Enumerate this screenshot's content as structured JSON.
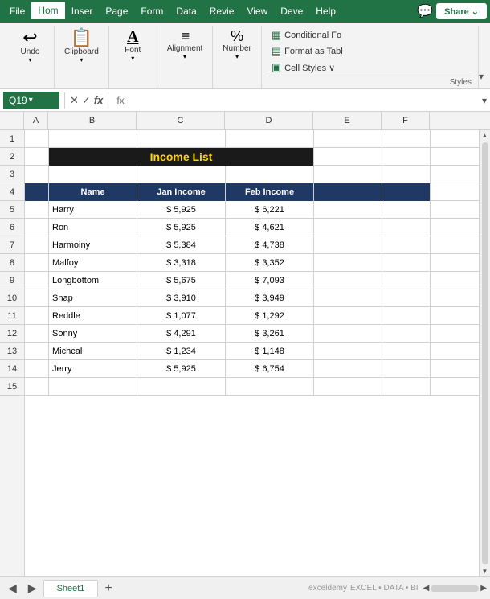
{
  "menu": {
    "items": [
      {
        "label": "File",
        "active": false
      },
      {
        "label": "Hom",
        "active": true
      },
      {
        "label": "Inser",
        "active": false
      },
      {
        "label": "Page",
        "active": false
      },
      {
        "label": "Form",
        "active": false
      },
      {
        "label": "Data",
        "active": false
      },
      {
        "label": "Revie",
        "active": false
      },
      {
        "label": "View",
        "active": false
      },
      {
        "label": "Deve",
        "active": false
      },
      {
        "label": "Help",
        "active": false
      }
    ],
    "share_label": "Share"
  },
  "ribbon": {
    "groups": [
      {
        "label": "Undo",
        "icon": "↩"
      },
      {
        "label": "Clipboard",
        "icon": "📋"
      },
      {
        "label": "Font",
        "icon": "A"
      },
      {
        "label": "Alignment",
        "icon": "≡"
      },
      {
        "label": "Number",
        "icon": "%"
      }
    ],
    "right_items": [
      {
        "label": "Conditional Fo",
        "icon": "▦"
      },
      {
        "label": "Format as Tabl",
        "icon": "▤"
      },
      {
        "label": "Cell Styles ∨",
        "icon": "▣"
      }
    ],
    "styles_label": "Styles"
  },
  "formula_bar": {
    "cell_ref": "Q19",
    "formula": "fx"
  },
  "columns": [
    "A",
    "B",
    "C",
    "D",
    "E",
    "F"
  ],
  "rows": [
    "1",
    "2",
    "3",
    "4",
    "5",
    "6",
    "7",
    "8",
    "9",
    "10",
    "11",
    "12",
    "13",
    "14",
    "15"
  ],
  "table": {
    "title": "Income List",
    "headers": [
      "Name",
      "Jan Income",
      "Feb Income"
    ],
    "data": [
      {
        "name": "Harry",
        "jan": "$ 5,925",
        "feb": "$ 6,221"
      },
      {
        "name": "Ron",
        "jan": "$ 5,925",
        "feb": "$ 4,621"
      },
      {
        "name": "Harmoiny",
        "jan": "$ 5,384",
        "feb": "$ 4,738"
      },
      {
        "name": "Malfoy",
        "jan": "$ 3,318",
        "feb": "$ 3,352"
      },
      {
        "name": "Longbottom",
        "jan": "$ 5,675",
        "feb": "$ 7,093"
      },
      {
        "name": "Snap",
        "jan": "$ 3,910",
        "feb": "$ 3,949"
      },
      {
        "name": "Reddle",
        "jan": "$ 1,077",
        "feb": "$ 1,292"
      },
      {
        "name": "Sonny",
        "jan": "$ 4,291",
        "feb": "$ 3,261"
      },
      {
        "name": "Michcal",
        "jan": "$ 1,234",
        "feb": "$ 1,148"
      },
      {
        "name": "Jerry",
        "jan": "$ 5,925",
        "feb": "$ 6,754"
      }
    ]
  },
  "sheet": {
    "tab_label": "Sheet1"
  },
  "colors": {
    "excel_green": "#217346",
    "header_bg": "#1F3864",
    "title_bg": "#1a1a1a",
    "title_text": "#FFD700"
  }
}
